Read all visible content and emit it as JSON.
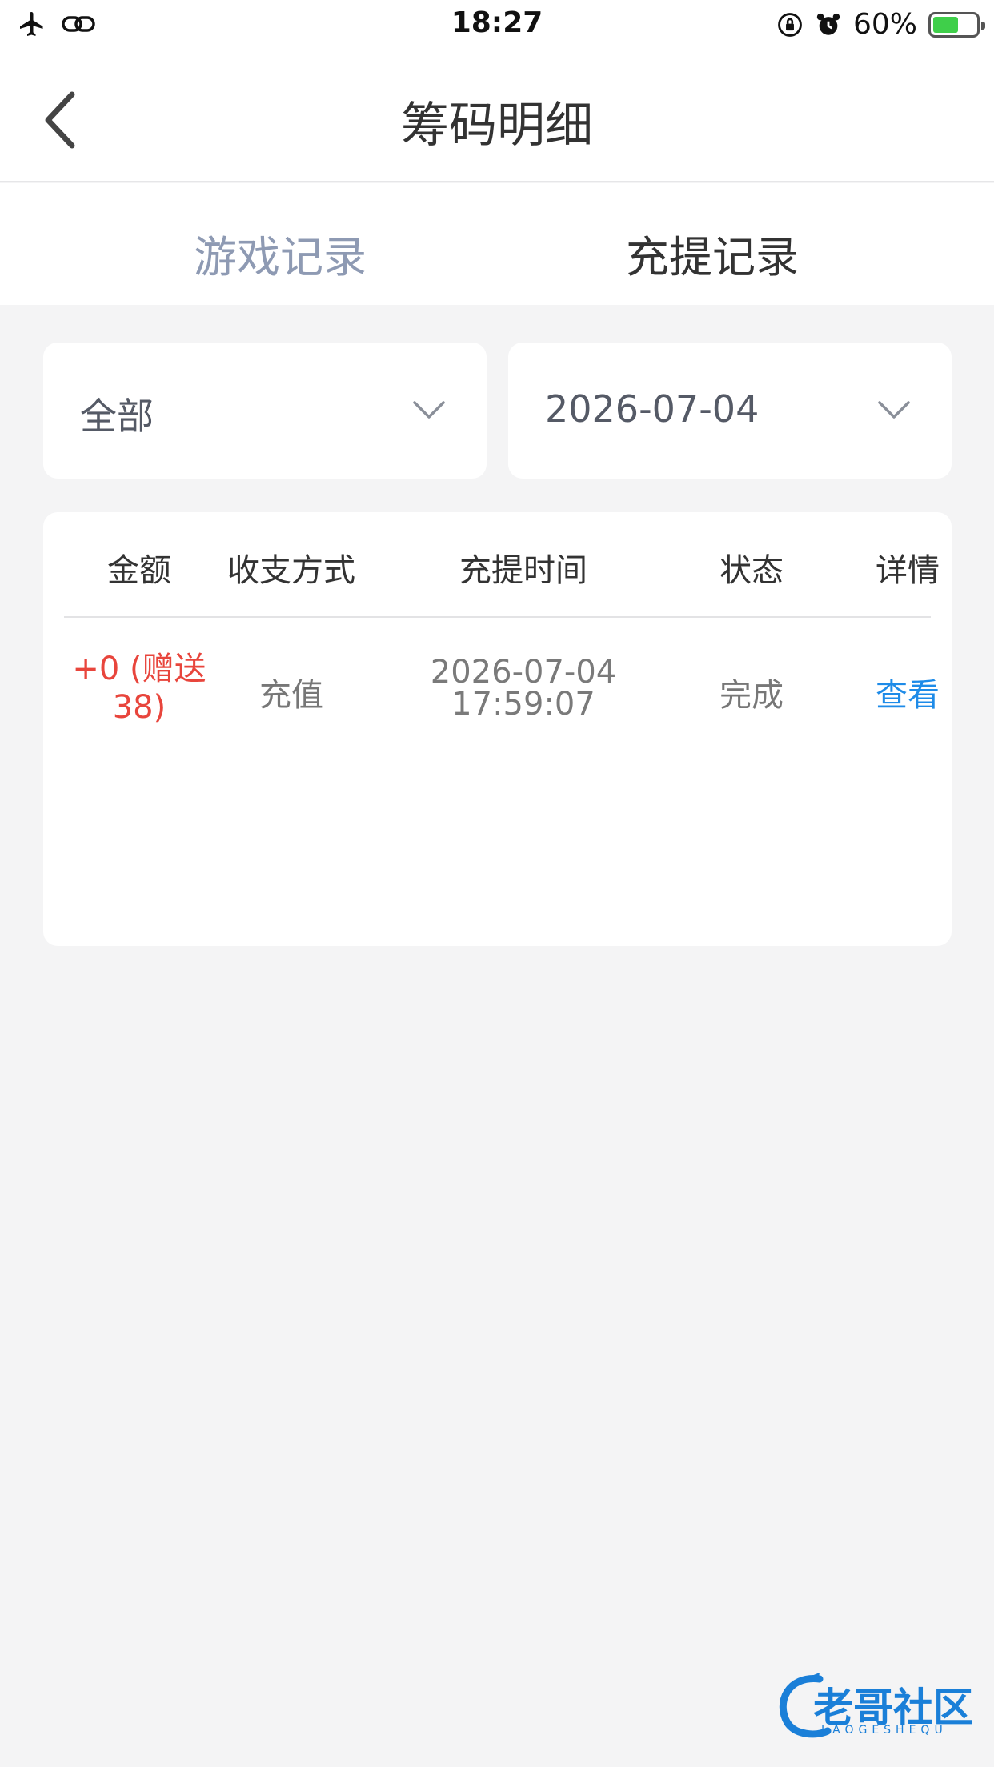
{
  "status_bar": {
    "time": "18:27",
    "battery_percent": "60%",
    "battery_level": 0.6,
    "icons": [
      "airplane-icon",
      "link-icon",
      "orientation-lock-icon",
      "alarm-icon",
      "battery-charging-icon"
    ]
  },
  "nav": {
    "title": "筹码明细",
    "back_icon": "chevron-left-icon"
  },
  "tabs": [
    {
      "label": "游戏记录",
      "active": false
    },
    {
      "label": "充提记录",
      "active": true
    }
  ],
  "filters": {
    "type_select": {
      "value": "全部"
    },
    "date_select": {
      "value": "2026-07-04"
    }
  },
  "table": {
    "columns": [
      "金额",
      "收支方式",
      "充提时间",
      "状态",
      "详情"
    ],
    "rows": [
      {
        "amount_line1": "+0 (赠送",
        "amount_line2": "38)",
        "method": "充值",
        "date": "2026-07-04",
        "time": "17:59:07",
        "status": "完成",
        "detail": "查看"
      }
    ]
  },
  "colors": {
    "accent_link": "#1e8be8",
    "amount_red": "#e8453c",
    "inactive_tab": "#8e9ab3",
    "background": "#f4f4f5"
  },
  "watermark": {
    "text": "老哥社区",
    "sub": "LAOGESHEQU"
  }
}
